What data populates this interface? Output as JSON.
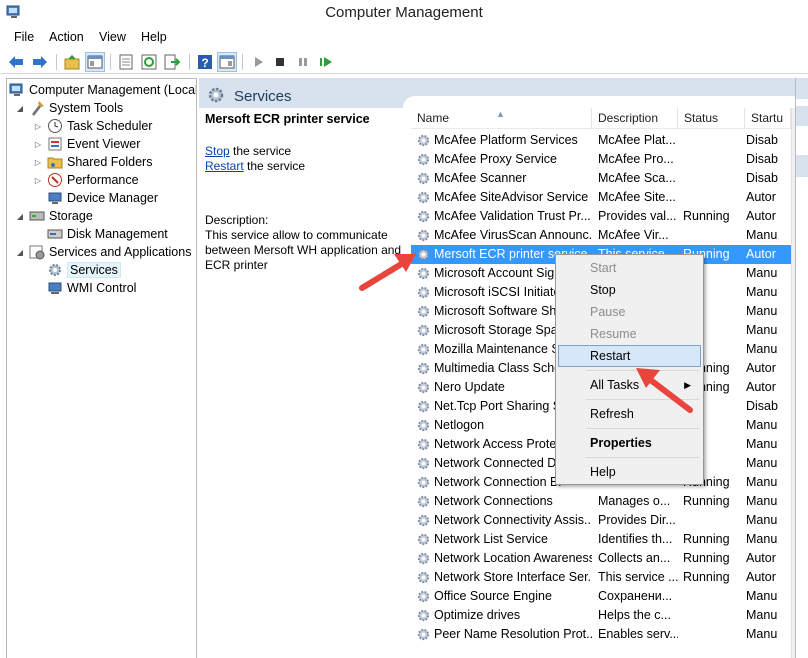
{
  "window": {
    "title": "Computer Management"
  },
  "menubar": {
    "items": [
      "File",
      "Action",
      "View",
      "Help"
    ]
  },
  "toolbar": {
    "buttons": [
      "back-icon",
      "forward-icon",
      "up-icon",
      "show-hide-tree-icon",
      "export-list-icon",
      "refresh-icon",
      "export-icon",
      "help-icon",
      "show-hide-action-pane-icon",
      "start-service-icon",
      "stop-service-icon",
      "pause-service-icon",
      "restart-service-icon"
    ]
  },
  "tree": {
    "root": "Computer Management (Local",
    "system_tools": "System Tools",
    "task_scheduler": "Task Scheduler",
    "event_viewer": "Event Viewer",
    "shared_folders": "Shared Folders",
    "performance": "Performance",
    "device_manager": "Device Manager",
    "storage": "Storage",
    "disk_management": "Disk Management",
    "services_apps": "Services and Applications",
    "services": "Services",
    "wmi": "WMI Control"
  },
  "services_pane": {
    "title": "Services",
    "selected_service": "Mersoft ECR printer service",
    "stop_link": "Stop",
    "stop_suffix": " the service",
    "restart_link": "Restart",
    "restart_suffix": " the service",
    "description_label": "Description:",
    "description_text": "This service allow to communicate between Mersoft WH application and ECR printer"
  },
  "columns": {
    "name": "Name",
    "description": "Description",
    "status": "Status",
    "startup": "Startu"
  },
  "rows": [
    {
      "name": "McAfee Platform Services",
      "desc": "McAfee Plat...",
      "status": "",
      "startup": "Disab"
    },
    {
      "name": "McAfee Proxy Service",
      "desc": "McAfee Pro...",
      "status": "",
      "startup": "Disab"
    },
    {
      "name": "McAfee Scanner",
      "desc": "McAfee Sca...",
      "status": "",
      "startup": "Disab"
    },
    {
      "name": "McAfee SiteAdvisor Service",
      "desc": "McAfee Site...",
      "status": "",
      "startup": "Autor"
    },
    {
      "name": "McAfee Validation Trust Pr...",
      "desc": "Provides val...",
      "status": "Running",
      "startup": "Autor"
    },
    {
      "name": "McAfee VirusScan Announc...",
      "desc": "McAfee Vir...",
      "status": "",
      "startup": "Manu"
    },
    {
      "name": "Mersoft ECR printer service",
      "desc": "This service...",
      "status": "Running",
      "startup": "Autor"
    },
    {
      "name": "Microsoft Account Sign-in",
      "desc": "",
      "status": "",
      "startup": "Manu"
    },
    {
      "name": "Microsoft iSCSI Initiator",
      "desc": "",
      "status": "",
      "startup": "Manu"
    },
    {
      "name": "Microsoft Software Shadow",
      "desc": "",
      "status": "",
      "startup": "Manu"
    },
    {
      "name": "Microsoft Storage Spaces",
      "desc": "",
      "status": "",
      "startup": "Manu"
    },
    {
      "name": "Mozilla Maintenance Se",
      "desc": "",
      "status": "",
      "startup": "Manu"
    },
    {
      "name": "Multimedia Class Schedu",
      "desc": "",
      "status": "Running",
      "startup": "Autor"
    },
    {
      "name": "Nero Update",
      "desc": "",
      "status": "Running",
      "startup": "Autor"
    },
    {
      "name": "Net.Tcp Port Sharing Se",
      "desc": "",
      "status": "",
      "startup": "Disab"
    },
    {
      "name": "Netlogon",
      "desc": "",
      "status": "",
      "startup": "Manu"
    },
    {
      "name": "Network Access Protect",
      "desc": "",
      "status": "",
      "startup": "Manu"
    },
    {
      "name": "Network Connected De",
      "desc": "",
      "status": "",
      "startup": "Manu"
    },
    {
      "name": "Network Connection Br",
      "desc": "",
      "status": "Running",
      "startup": "Manu"
    },
    {
      "name": "Network Connections",
      "desc": "Manages o...",
      "status": "Running",
      "startup": "Manu"
    },
    {
      "name": "Network Connectivity Assis...",
      "desc": "Provides Dir...",
      "status": "",
      "startup": "Manu"
    },
    {
      "name": "Network List Service",
      "desc": "Identifies th...",
      "status": "Running",
      "startup": "Manu"
    },
    {
      "name": "Network Location Awareness",
      "desc": "Collects an...",
      "status": "Running",
      "startup": "Autor"
    },
    {
      "name": "Network Store Interface Ser...",
      "desc": "This service ...",
      "status": "Running",
      "startup": "Autor"
    },
    {
      "name": "Office  Source Engine",
      "desc": "Сохранени...",
      "status": "",
      "startup": "Manu"
    },
    {
      "name": "Optimize drives",
      "desc": "Helps the c...",
      "status": "",
      "startup": "Manu"
    },
    {
      "name": "Peer Name Resolution Prot...",
      "desc": "Enables serv...",
      "status": "",
      "startup": "Manu"
    }
  ],
  "context_menu": {
    "start": "Start",
    "stop": "Stop",
    "pause": "Pause",
    "resume": "Resume",
    "restart": "Restart",
    "all_tasks": "All Tasks",
    "refresh": "Refresh",
    "properties": "Properties",
    "help": "Help"
  },
  "colors": {
    "selection": "#3399ff",
    "header_band": "#d7e2ee",
    "annotation_arrow": "#e8453c",
    "link": "#0645ad"
  }
}
